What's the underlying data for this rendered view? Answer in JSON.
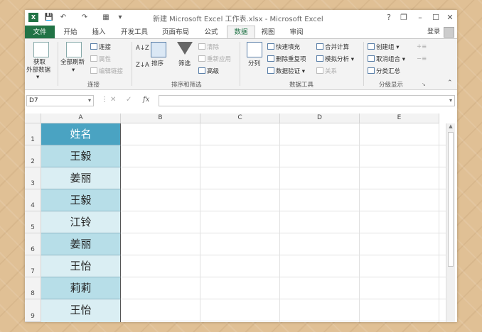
{
  "window": {
    "title": "新建 Microsoft Excel 工作表.xlsx - Microsoft Excel",
    "logo": "X",
    "help": "?",
    "restore": "❐",
    "minimize": "–",
    "maximize": "☐",
    "close": "✕"
  },
  "quick_access": {
    "save": "💾",
    "undo": "↶",
    "redo": "↷",
    "form": "▦",
    "more": "▾"
  },
  "tabs": [
    "文件",
    "开始",
    "插入",
    "开发工具",
    "页面布局",
    "公式",
    "数据",
    "视图",
    "审阅"
  ],
  "active_tab": "数据",
  "account": {
    "login": "登录"
  },
  "ribbon": {
    "get_external": {
      "line1": "获取",
      "line2": "外部数据",
      "arrow": "▾"
    },
    "connections": {
      "refresh_all": "全部刷新",
      "refresh_arrow": "▾",
      "connect": "连接",
      "properties": "属性",
      "edit_links": "编辑链接",
      "label": "连接"
    },
    "sort_filter": {
      "sort_asc": "A↓Z",
      "sort_desc": "Z↓A",
      "sort": "排序",
      "filter": "筛选",
      "clear": "清除",
      "reapply": "重新应用",
      "advanced": "高级",
      "label": "排序和筛选"
    },
    "data_tools": {
      "text_to_columns": "分列",
      "flash_fill": "快速填充",
      "remove_duplicates": "删除重复项",
      "data_validation": "数据验证",
      "consolidate": "合并计算",
      "what_if": "模拟分析",
      "relationships": "关系",
      "label": "数据工具"
    },
    "outline": {
      "group": "创建组",
      "ungroup": "取消组合",
      "subtotal": "分类汇总",
      "show_detail": "+≡",
      "hide_detail": "−≡",
      "label": "分级显示"
    },
    "collapse": "⌃"
  },
  "formula_bar": {
    "name_box": "D7",
    "cancel": "✕",
    "enter": "✓",
    "fx": "fx",
    "value": ""
  },
  "sheet": {
    "columns": [
      "A",
      "B",
      "C",
      "D",
      "E"
    ],
    "rows": [
      "1",
      "2",
      "3",
      "4",
      "5",
      "6",
      "7",
      "8",
      "9"
    ],
    "col_a": [
      "姓名",
      "王毅",
      "姜丽",
      "王毅",
      "江铃",
      "姜丽",
      "王怡",
      "莉莉",
      "王怡"
    ]
  },
  "colors": {
    "excel_green": "#217346",
    "header_fill": "#4aa3c2",
    "band_dark": "#b7dee8",
    "band_light": "#daeef3"
  }
}
